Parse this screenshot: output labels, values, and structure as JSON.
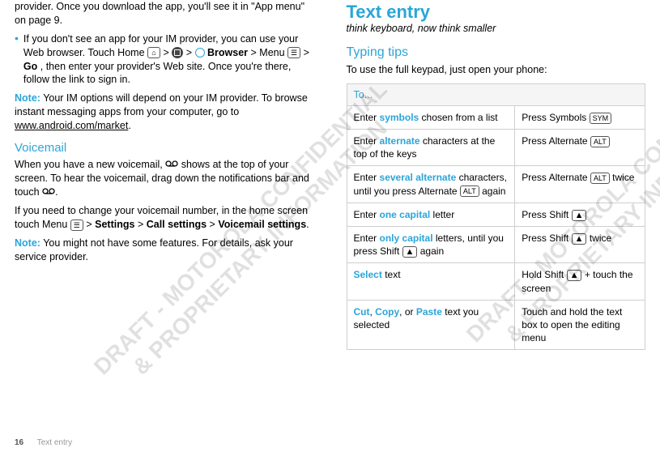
{
  "watermarks": {
    "w1": "DRAFT - MOTOROLA CONFIDENTIAL\n& PROPRIETARY INFORMATION",
    "w2": "DRAFT - MOTOROLA CONFIDENTIAL\n& PROPRIETARY INFORMATION"
  },
  "left": {
    "intro_tail": "provider. Once you download the app, you'll see it in \"App menu\" on page 9.",
    "bullet_pre": "If you don't see an app for your IM provider, you can use your Web browser. Touch Home ",
    "bullet_mid1": " > ",
    "bullet_mid2": " > ",
    "browser_label": "Browser",
    "bullet_mid3": " > Menu ",
    "bullet_mid4": " > ",
    "go_label": "Go",
    "bullet_post": ", then enter your provider's Web site. Once you're there, follow the link to sign in.",
    "note1_label": "Note:",
    "note1_text": " Your IM options will depend on your IM provider. To browse instant messaging apps from your computer, go to ",
    "note1_link": "www.android.com/market",
    "voicemail_h": "Voicemail",
    "vm_p1_a": "When you have a new voicemail, ",
    "vm_p1_b": " shows at the top of your screen. To hear the voicemail, drag down the notifications bar and touch ",
    "vm_p2_a": "If you need to change your voicemail number, in the home screen touch Menu ",
    "vm_p2_b": " > ",
    "settings_label": "Settings",
    "vm_p2_c": " > ",
    "callsettings_label": "Call settings",
    "vm_p2_d": " > ",
    "vmsettings_label": "Voicemail settings",
    "note2_label": "Note:",
    "note2_text": " You might not have some features. For details, ask your service provider."
  },
  "right": {
    "title": "Text entry",
    "subtitle": "think keyboard, now think smaller",
    "tips_h": "Typing tips",
    "tips_intro": "To use the full keypad, just open your phone:",
    "table_header": "To...",
    "rows": [
      {
        "l_pre": "Enter ",
        "l_kw": "symbols",
        "l_post": " chosen from a list",
        "r_pre": "Press Symbols ",
        "r_key": "SYM"
      },
      {
        "l_pre": "Enter ",
        "l_kw": "alternate",
        "l_post": " characters at the top of the keys",
        "r_pre": "Press Alternate ",
        "r_key": "ALT"
      },
      {
        "l_pre": "Enter ",
        "l_kw": "several alternate",
        "l_post": " characters, until you press Alternate ",
        "l_key": "ALT",
        "l_post2": " again",
        "r_pre": "Press Alternate ",
        "r_key": "ALT",
        "r_post": " twice"
      },
      {
        "l_pre": "Enter ",
        "l_kw": "one capital",
        "l_post": " letter",
        "r_pre": "Press Shift ",
        "r_shift": true
      },
      {
        "l_pre": "Enter ",
        "l_kw": "only capital",
        "l_post": " letters, until you press Shift ",
        "l_shift": true,
        "l_post2": " again",
        "r_pre": "Press Shift ",
        "r_shift": true,
        "r_post": " twice"
      },
      {
        "l_kw": "Select",
        "l_post": " text",
        "r_pre": "Hold Shift ",
        "r_shift": true,
        "r_post": " + touch the screen"
      },
      {
        "l_kw": "Cut",
        "l_mid1": ", ",
        "l_kw2": "Copy",
        "l_mid2": ", or ",
        "l_kw3": "Paste",
        "l_post": " text you selected",
        "r_text": "Touch and hold the text box to open the editing menu"
      }
    ]
  },
  "footer": {
    "page": "16",
    "section": "Text entry"
  }
}
